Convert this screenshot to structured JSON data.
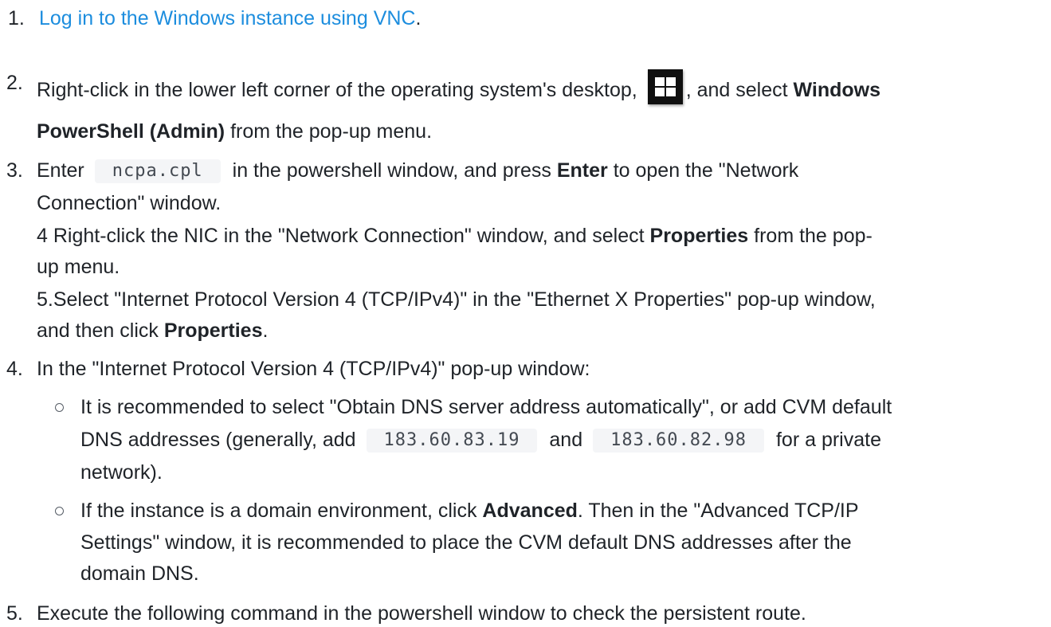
{
  "steps": {
    "s1": {
      "num": "1.",
      "link": "Log in to the Windows instance using VNC",
      "after": "."
    },
    "s2": {
      "num": "2.",
      "pre": "Right-click in the lower left corner of the operating system's desktop,",
      "mid": ", and select",
      "bold1": "Windows",
      "bold2": "PowerShell (Admin)",
      "post": "from the pop-up menu.",
      "icon": "windows-logo-icon"
    },
    "s3": {
      "num": "3.",
      "pre": "Enter",
      "code": "ncpa.cpl",
      "mid": "in the powershell window, and press",
      "bold": "Enter",
      "post": "to open the \"Network",
      "line2": "Connection\" window.",
      "line3_pre": "4 Right-click the NIC in the \"Network Connection\" window, and select",
      "line3_bold": "Properties",
      "line3_post": "from the pop-",
      "line4": "up menu.",
      "line5": "5.Select \"Internet Protocol Version 4 (TCP/IPv4)\" in the \"Ethernet X Properties\" pop-up window,",
      "line6_pre": "and then click",
      "line6_bold": "Properties",
      "line6_post": "."
    },
    "s4": {
      "num": "4.",
      "text": "In the \"Internet Protocol Version 4 (TCP/IPv4)\" pop-up window:",
      "b1_line1": "It is recommended to select \"Obtain DNS server address automatically\", or add CVM default",
      "b1_line2_pre": "DNS addresses (generally, add",
      "b1_code1": "183.60.83.19",
      "b1_and": "and",
      "b1_code2": "183.60.82.98",
      "b1_line2_post": "for a private",
      "b1_line3": "network).",
      "b2_line1_pre": "If the instance is a domain environment, click",
      "b2_bold": "Advanced",
      "b2_line1_post": ". Then in the \"Advanced TCP/IP",
      "b2_line2": "Settings\" window, it is recommended to place the CVM default DNS addresses after the",
      "b2_line3": "domain DNS."
    },
    "s5": {
      "num": "5.",
      "text": "Execute the following command in the powershell window to check the persistent route."
    }
  }
}
